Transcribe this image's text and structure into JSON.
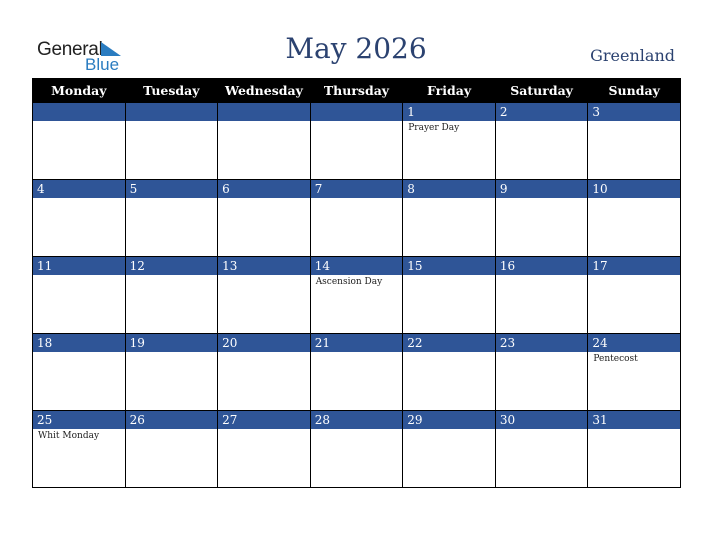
{
  "logo": {
    "general": "General",
    "blue": "Blue"
  },
  "title": "May 2026",
  "country": "Greenland",
  "weekdays": [
    "Monday",
    "Tuesday",
    "Wednesday",
    "Thursday",
    "Friday",
    "Saturday",
    "Sunday"
  ],
  "weeks": [
    [
      {
        "day": "",
        "event": ""
      },
      {
        "day": "",
        "event": ""
      },
      {
        "day": "",
        "event": ""
      },
      {
        "day": "",
        "event": ""
      },
      {
        "day": "1",
        "event": "Prayer Day"
      },
      {
        "day": "2",
        "event": ""
      },
      {
        "day": "3",
        "event": ""
      }
    ],
    [
      {
        "day": "4",
        "event": ""
      },
      {
        "day": "5",
        "event": ""
      },
      {
        "day": "6",
        "event": ""
      },
      {
        "day": "7",
        "event": ""
      },
      {
        "day": "8",
        "event": ""
      },
      {
        "day": "9",
        "event": ""
      },
      {
        "day": "10",
        "event": ""
      }
    ],
    [
      {
        "day": "11",
        "event": ""
      },
      {
        "day": "12",
        "event": ""
      },
      {
        "day": "13",
        "event": ""
      },
      {
        "day": "14",
        "event": "Ascension Day"
      },
      {
        "day": "15",
        "event": ""
      },
      {
        "day": "16",
        "event": ""
      },
      {
        "day": "17",
        "event": ""
      }
    ],
    [
      {
        "day": "18",
        "event": ""
      },
      {
        "day": "19",
        "event": ""
      },
      {
        "day": "20",
        "event": ""
      },
      {
        "day": "21",
        "event": ""
      },
      {
        "day": "22",
        "event": ""
      },
      {
        "day": "23",
        "event": ""
      },
      {
        "day": "24",
        "event": "Pentecost"
      }
    ],
    [
      {
        "day": "25",
        "event": "Whit Monday"
      },
      {
        "day": "26",
        "event": ""
      },
      {
        "day": "27",
        "event": ""
      },
      {
        "day": "28",
        "event": ""
      },
      {
        "day": "29",
        "event": ""
      },
      {
        "day": "30",
        "event": ""
      },
      {
        "day": "31",
        "event": ""
      }
    ]
  ]
}
